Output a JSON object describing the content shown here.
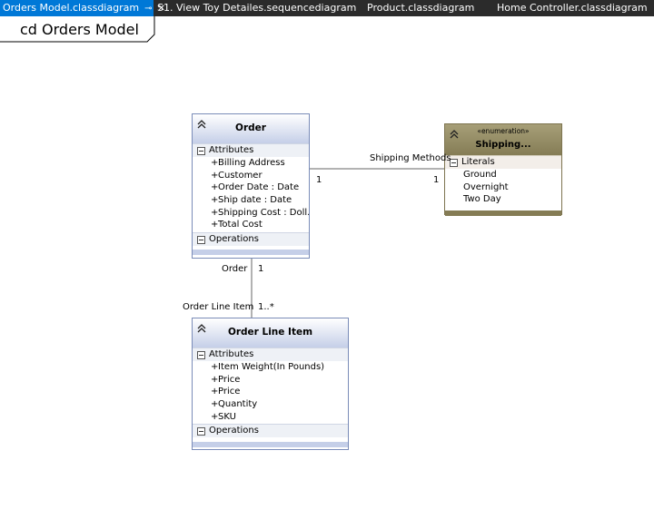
{
  "tabs": [
    {
      "label": "Orders Model.classdiagram",
      "active": true,
      "pin": "⊸",
      "close": "✕"
    },
    {
      "label": "S1. View Toy Detailes.sequencediagram"
    },
    {
      "label": "Product.classdiagram"
    },
    {
      "label": "Home Controller.classdiagram"
    }
  ],
  "frame_title": "cd Orders Model",
  "classes": {
    "order": {
      "name": "Order",
      "attributes_label": "Attributes",
      "attributes": [
        "Billing Address",
        "Customer",
        "Order Date : Date",
        "Ship date : Date",
        "Shipping Cost : Doll...",
        "Total Cost"
      ],
      "operations_label": "Operations"
    },
    "order_line_item": {
      "name": "Order Line Item",
      "attributes_label": "Attributes",
      "attributes": [
        "Item Weight(In Pounds)",
        "Price",
        "Price",
        "Quantity",
        "SKU"
      ],
      "operations_label": "Operations"
    },
    "shipping": {
      "stereotype": "«enumeration»",
      "name": "Shipping...",
      "literals_label": "Literals",
      "literals": [
        "Ground",
        "Overnight",
        "Two Day"
      ]
    }
  },
  "associations": {
    "order_shipping": {
      "label": "Shipping Methods",
      "source_mult": "1",
      "target_mult": "1"
    },
    "order_lineitem": {
      "source_role": "Order",
      "source_mult": "1",
      "target_role": "Order Line Item",
      "target_mult": "1..*"
    }
  },
  "plus_sign": "+",
  "colors": {
    "tab_active": "#0078d7",
    "tabbar": "#2b2b2b",
    "class_header": "#c5cfe8",
    "enum_header": "#857c55"
  }
}
